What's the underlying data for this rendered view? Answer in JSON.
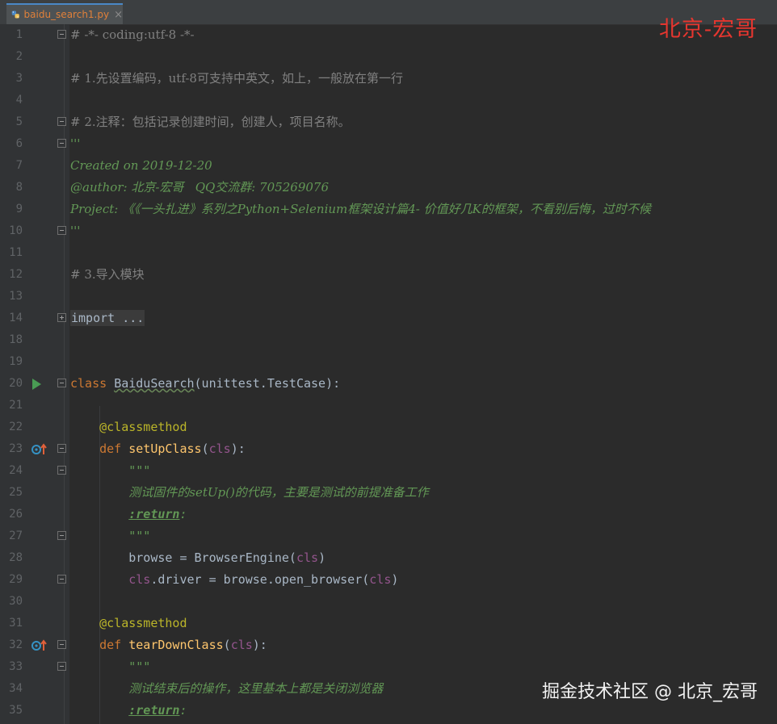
{
  "tab": {
    "filename": "baidu_search1.py",
    "close": "×"
  },
  "watermark_top": "北京-宏哥",
  "watermark_bottom": "掘金技术社区 @ 北京_宏哥",
  "lines": [
    {
      "n": "1",
      "segs": [
        [
          "cmt",
          "# -*- coding:utf-8 -*-"
        ]
      ]
    },
    {
      "n": "2",
      "segs": []
    },
    {
      "n": "3",
      "segs": [
        [
          "cmt",
          "# 1.先设置编码，utf-8可支持中英文，如上，一般放在第一行"
        ]
      ]
    },
    {
      "n": "4",
      "segs": []
    },
    {
      "n": "5",
      "segs": [
        [
          "cmt",
          "# 2.注释：包括记录创建时间，创建人，项目名称。"
        ]
      ]
    },
    {
      "n": "6",
      "segs": [
        [
          "doc",
          "'''"
        ]
      ]
    },
    {
      "n": "7",
      "segs": [
        [
          "doc",
          "Created on 2019-12-20"
        ]
      ]
    },
    {
      "n": "8",
      "segs": [
        [
          "doc",
          "@author: 北京-宏哥   QQ交流群: 705269076"
        ]
      ]
    },
    {
      "n": "9",
      "segs": [
        [
          "doc",
          "Project: 《《一头扎进》系列之Python+Selenium框架设计篇4- 价值好几K的框架，不看别后悔，过时不候"
        ]
      ]
    },
    {
      "n": "10",
      "segs": [
        [
          "doc",
          "'''"
        ]
      ]
    },
    {
      "n": "11",
      "segs": []
    },
    {
      "n": "12",
      "segs": [
        [
          "cmt",
          "# 3.导入模块"
        ]
      ]
    },
    {
      "n": "13",
      "segs": []
    },
    {
      "n": "14",
      "segs": [
        [
          "fold-collapsed",
          "import ..."
        ]
      ]
    },
    {
      "n": "18",
      "segs": []
    },
    {
      "n": "19",
      "segs": []
    },
    {
      "n": "20",
      "segs": [
        [
          "kw",
          "class "
        ],
        [
          "wavy-plain",
          "BaiduSearch"
        ],
        [
          "plain",
          "(unittest.TestCase):"
        ]
      ]
    },
    {
      "n": "21",
      "segs": []
    },
    {
      "n": "22",
      "segs": [
        [
          "plain",
          "    "
        ],
        [
          "deco",
          "@classmethod"
        ]
      ]
    },
    {
      "n": "23",
      "segs": [
        [
          "plain",
          "    "
        ],
        [
          "kw",
          "def "
        ],
        [
          "fn",
          "setUpClass"
        ],
        [
          "plain",
          "("
        ],
        [
          "cls",
          "cls"
        ],
        [
          "plain",
          "):"
        ]
      ]
    },
    {
      "n": "24",
      "segs": [
        [
          "plain",
          "        "
        ],
        [
          "doc-mono",
          "\"\"\""
        ]
      ]
    },
    {
      "n": "25",
      "segs": [
        [
          "plain",
          "        "
        ],
        [
          "doc",
          "测试固件的setUp()的代码，主要是测试的前提准备工作"
        ]
      ]
    },
    {
      "n": "26",
      "segs": [
        [
          "plain",
          "        "
        ],
        [
          "doc-tag",
          ":return"
        ],
        [
          "doc-mono",
          ":"
        ]
      ]
    },
    {
      "n": "27",
      "segs": [
        [
          "plain",
          "        "
        ],
        [
          "doc-mono",
          "\"\"\""
        ]
      ]
    },
    {
      "n": "28",
      "segs": [
        [
          "plain",
          "        browse = BrowserEngine("
        ],
        [
          "cls",
          "cls"
        ],
        [
          "plain",
          ")"
        ]
      ]
    },
    {
      "n": "29",
      "segs": [
        [
          "plain",
          "        "
        ],
        [
          "cls",
          "cls"
        ],
        [
          "plain",
          ".driver = browse.open_browser("
        ],
        [
          "cls",
          "cls"
        ],
        [
          "plain",
          ")"
        ]
      ]
    },
    {
      "n": "30",
      "segs": []
    },
    {
      "n": "31",
      "segs": [
        [
          "plain",
          "    "
        ],
        [
          "deco",
          "@classmethod"
        ]
      ]
    },
    {
      "n": "32",
      "segs": [
        [
          "plain",
          "    "
        ],
        [
          "kw",
          "def "
        ],
        [
          "fn",
          "tearDownClass"
        ],
        [
          "plain",
          "("
        ],
        [
          "cls",
          "cls"
        ],
        [
          "plain",
          "):"
        ]
      ]
    },
    {
      "n": "33",
      "segs": [
        [
          "plain",
          "        "
        ],
        [
          "doc-mono",
          "\"\"\""
        ]
      ]
    },
    {
      "n": "34",
      "segs": [
        [
          "plain",
          "        "
        ],
        [
          "doc",
          "测试结束后的操作，这里基本上都是关闭浏览器"
        ]
      ]
    },
    {
      "n": "35",
      "segs": [
        [
          "plain",
          "        "
        ],
        [
          "doc-tag",
          ":return"
        ],
        [
          "doc-mono",
          ":"
        ]
      ]
    }
  ],
  "gutter": {
    "folds": {
      "1": "minus",
      "5": "minus",
      "6": "minus",
      "10": "minus",
      "14": "plus",
      "20": "minus",
      "23": "minus",
      "24": "minus",
      "27": "minus",
      "29": "minus",
      "32": "minus",
      "33": "minus"
    },
    "run_lines": [
      "20"
    ],
    "override_lines": [
      "23",
      "32"
    ]
  },
  "colors": {
    "background": "#2b2b2b",
    "comment": "#808080",
    "docstring": "#629755",
    "keyword": "#cc7832",
    "function": "#ffc66d",
    "decorator": "#bbb529",
    "self_param": "#94558d",
    "text": "#a9b7c6"
  }
}
